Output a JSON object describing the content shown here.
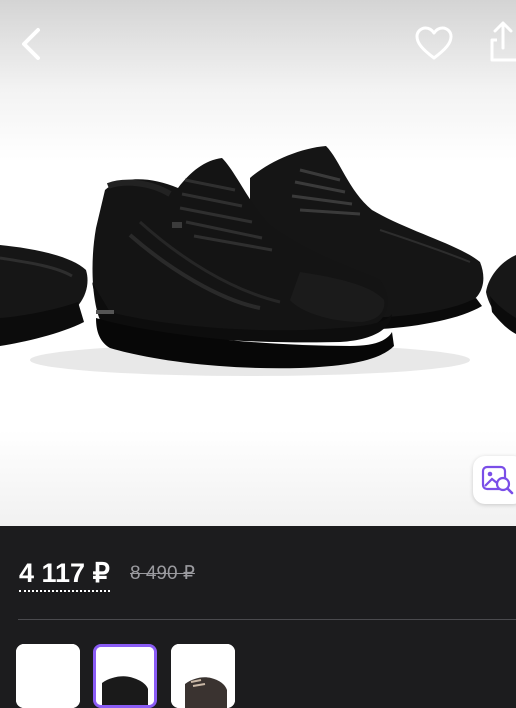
{
  "header": {
    "back_icon": "chevron-left-icon",
    "favorite_icon": "heart-outline-icon",
    "share_icon": "share-icon"
  },
  "gallery": {
    "visual_search_icon": "image-search-icon",
    "thumbnails": [
      {
        "selected": false
      },
      {
        "selected": true
      },
      {
        "selected": false
      }
    ],
    "selected_color": "#8a5cf5"
  },
  "price": {
    "current": "4 117 ₽",
    "old": "8 490 ₽"
  }
}
